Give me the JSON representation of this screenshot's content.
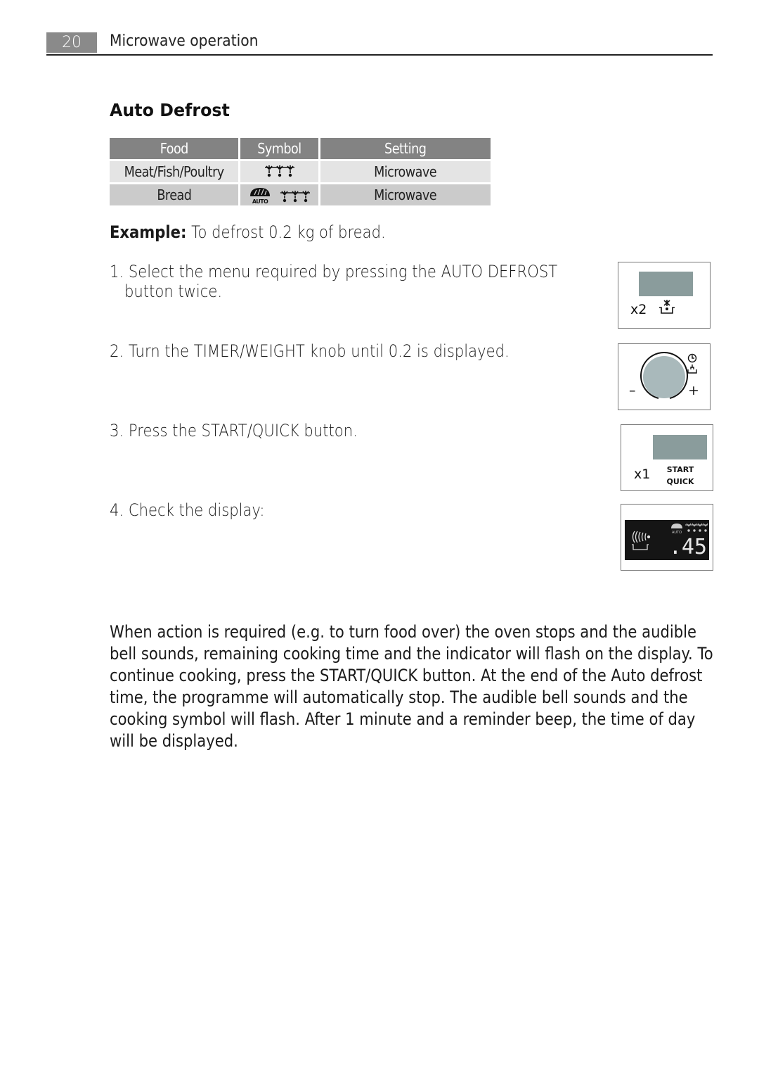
{
  "header": {
    "page_number": "20",
    "chapter_title": "Microwave operation"
  },
  "section": {
    "title": "Auto Defrost"
  },
  "table": {
    "columns": [
      "Food",
      "Symbol",
      "Setting"
    ],
    "rows": [
      {
        "food": "Meat/Fish/Poultry",
        "symbol": "defrost-icon",
        "setting": "Microwave"
      },
      {
        "food": "Bread",
        "symbol": "bread-auto-icon + defrost-icon",
        "symbol_label": "AUTO",
        "setting": "Microwave"
      }
    ]
  },
  "example": {
    "label": "Example:",
    "text": " To defrost 0.2 kg of bread."
  },
  "steps": [
    {
      "line1": "1. Select the menu required by pressing the AUTO DEFROST",
      "line2": "button twice."
    },
    {
      "line1": "2. Turn the TIMER/WEIGHT knob until 0.2 is displayed."
    },
    {
      "line1": "3. Press the START/QUICK button."
    },
    {
      "line1": "4. Check the display:"
    }
  ],
  "illustrations": {
    "auto_defrost_button": {
      "multiplier": "x2",
      "icon": "defrost-dish-icon"
    },
    "timer_weight_knob": {
      "minus": "–",
      "plus": "+",
      "icons": [
        "clock-icon",
        "weight-icon"
      ]
    },
    "start_quick_button": {
      "multiplier": "x1",
      "label_line1": "START",
      "label_line2": "QUICK"
    },
    "display": {
      "readout": ".45",
      "auto_label": "AUTO",
      "icons": [
        "microwave-waves-icon",
        "bread-auto-icon",
        "defrost-icon"
      ]
    }
  },
  "paragraph": {
    "lines": [
      "When action is required (e.g. to turn food over) the oven stops and the audible",
      "bell sounds, remaining cooking time and the indicator will flash on the display. To",
      "continue cooking, press the START/QUICK button. At the end of the Auto defrost",
      "time, the programme will automatically stop. The audible bell sounds and the",
      "cooking symbol will flash. After 1 minute and a reminder beep, the time of day",
      "will be displayed."
    ]
  },
  "colors": {
    "header_grey": "#8a8a8a",
    "table_header": "#838383",
    "row_light": "#e4e4e4",
    "row_dark": "#cbcbcb",
    "lcd_panel": "#8a9c9c",
    "knob": "#a9b9bb",
    "display_bg": "#151515"
  }
}
